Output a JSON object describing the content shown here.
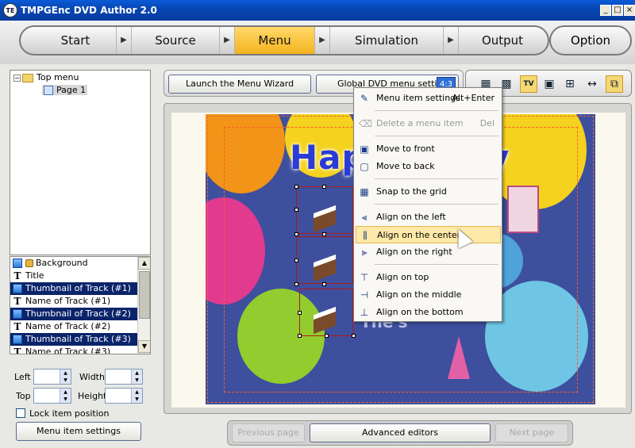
{
  "window": {
    "title": "TMPGEnc DVD Author 2.0",
    "icon_text": "TE"
  },
  "nav": {
    "steps": [
      "Start",
      "Source",
      "Menu",
      "Simulation",
      "Output"
    ],
    "active": "Menu",
    "option": "Option"
  },
  "tree": {
    "root": "Top menu",
    "child": "Page 1"
  },
  "layers": [
    {
      "label": "Background",
      "icon": "image",
      "locked": true,
      "selected": false
    },
    {
      "label": "Title",
      "icon": "text",
      "locked": false,
      "selected": false
    },
    {
      "label": "Thumbnail of Track (#1)",
      "icon": "image",
      "locked": false,
      "selected": true
    },
    {
      "label": "Name of Track (#1)",
      "icon": "text",
      "locked": false,
      "selected": false
    },
    {
      "label": "Thumbnail of Track (#2)",
      "icon": "image",
      "locked": false,
      "selected": true
    },
    {
      "label": "Name of Track (#2)",
      "icon": "text",
      "locked": false,
      "selected": false
    },
    {
      "label": "Thumbnail of Track (#3)",
      "icon": "image",
      "locked": false,
      "selected": true
    },
    {
      "label": "Name of Track (#3)",
      "icon": "text",
      "locked": false,
      "selected": false
    }
  ],
  "props": {
    "left": "Left",
    "top": "Top",
    "width": "Width",
    "height": "Height",
    "lock": "Lock item position",
    "settings_button": "Menu item settings"
  },
  "toolbar": {
    "wizard": "Launch the Menu Wizard",
    "global": "Global DVD menu settings",
    "aspect_badge": "4:3"
  },
  "canvas": {
    "title_visible": "Happ",
    "title_tail": "y",
    "track_text": "Tne's"
  },
  "context_menu": [
    {
      "label": "Menu item settings",
      "shortcut": "Alt+Enter",
      "icon": "pencil-icon",
      "glyph": "✎",
      "disabled": false,
      "highlight": false,
      "sep_after": true
    },
    {
      "label": "Delete a menu item",
      "shortcut": "Del",
      "icon": "eraser-icon",
      "glyph": "⌫",
      "disabled": true,
      "highlight": false,
      "sep_after": true
    },
    {
      "label": "Move to front",
      "shortcut": "",
      "icon": "bring-front-icon",
      "glyph": "▣",
      "disabled": false,
      "highlight": false,
      "sep_after": false
    },
    {
      "label": "Move to back",
      "shortcut": "",
      "icon": "send-back-icon",
      "glyph": "▢",
      "disabled": false,
      "highlight": false,
      "sep_after": true
    },
    {
      "label": "Snap to the grid",
      "shortcut": "",
      "icon": "grid-icon",
      "glyph": "▦",
      "disabled": false,
      "highlight": false,
      "sep_after": true
    },
    {
      "label": "Align on the left",
      "shortcut": "",
      "icon": "align-left-icon",
      "glyph": "⫷",
      "disabled": false,
      "highlight": false,
      "sep_after": false
    },
    {
      "label": "Align on the center",
      "shortcut": "",
      "icon": "align-center-icon",
      "glyph": "⫼",
      "disabled": false,
      "highlight": true,
      "sep_after": false
    },
    {
      "label": "Align on the right",
      "shortcut": "",
      "icon": "align-right-icon",
      "glyph": "⫸",
      "disabled": false,
      "highlight": false,
      "sep_after": true
    },
    {
      "label": "Align on top",
      "shortcut": "",
      "icon": "align-top-icon",
      "glyph": "⊤",
      "disabled": false,
      "highlight": false,
      "sep_after": false
    },
    {
      "label": "Align on the middle",
      "shortcut": "",
      "icon": "align-middle-icon",
      "glyph": "⊣",
      "disabled": false,
      "highlight": false,
      "sep_after": false
    },
    {
      "label": "Align on the bottom",
      "shortcut": "",
      "icon": "align-bottom-icon",
      "glyph": "⊥",
      "disabled": false,
      "highlight": false,
      "sep_after": false
    }
  ],
  "bottom": {
    "prev": "Previous page",
    "advanced": "Advanced editors",
    "next": "Next page"
  },
  "colors": {
    "accent": "#f5b31e",
    "selection": "#0a246a",
    "scene_bg": "#3e4f9e"
  }
}
